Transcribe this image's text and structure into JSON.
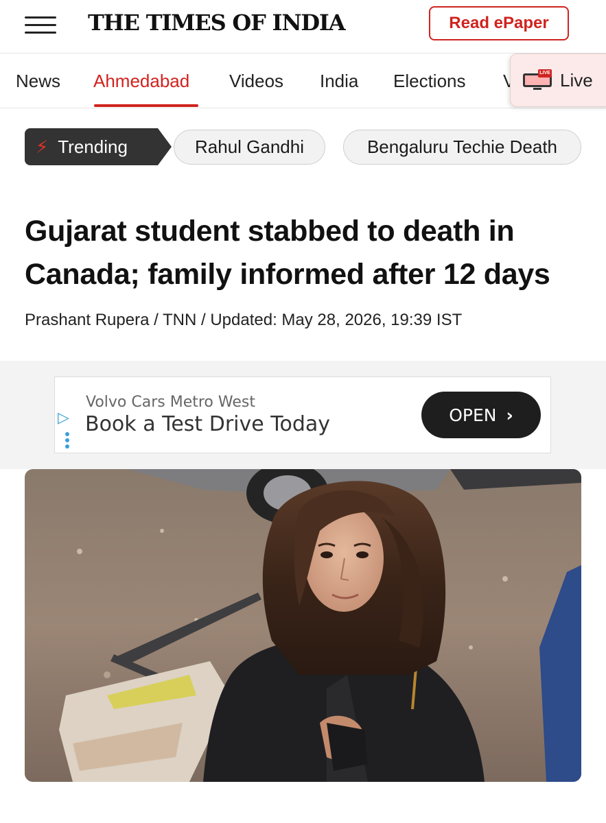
{
  "header": {
    "logo": "THE TIMES OF INDIA",
    "epaper_label": "Read ePaper",
    "menu_icon": "hamburger-menu-icon"
  },
  "nav": {
    "items": [
      {
        "label": "News",
        "active": false
      },
      {
        "label": "Ahmedabad",
        "active": true
      },
      {
        "label": "Videos",
        "active": false
      },
      {
        "label": "India",
        "active": false
      },
      {
        "label": "Elections",
        "active": false
      },
      {
        "label": "V",
        "active": false
      }
    ],
    "live": {
      "label": "Live",
      "badge": "LIVE",
      "icon": "live-tv-icon"
    }
  },
  "trending": {
    "label": "Trending",
    "icon": "lightning-bolt-icon",
    "chips": [
      "Rahul Gandhi",
      "Bengaluru Techie Death"
    ]
  },
  "article": {
    "headline_line1": "Gujarat student stabbed to death in",
    "headline_line2": "Canada; family informed after 12 days",
    "byline": "Prashant Rupera / TNN / Updated: May 28, 2026, 19:39 IST"
  },
  "ad": {
    "sponsor": "Volvo Cars Metro West",
    "title": "Book a Test Drive Today",
    "button_label": "OPEN",
    "icon": "adchoices-play-icon"
  },
  "colors": {
    "brand_red": "#d0231f",
    "trending_bg": "#333333",
    "live_bg": "#fceaea"
  }
}
